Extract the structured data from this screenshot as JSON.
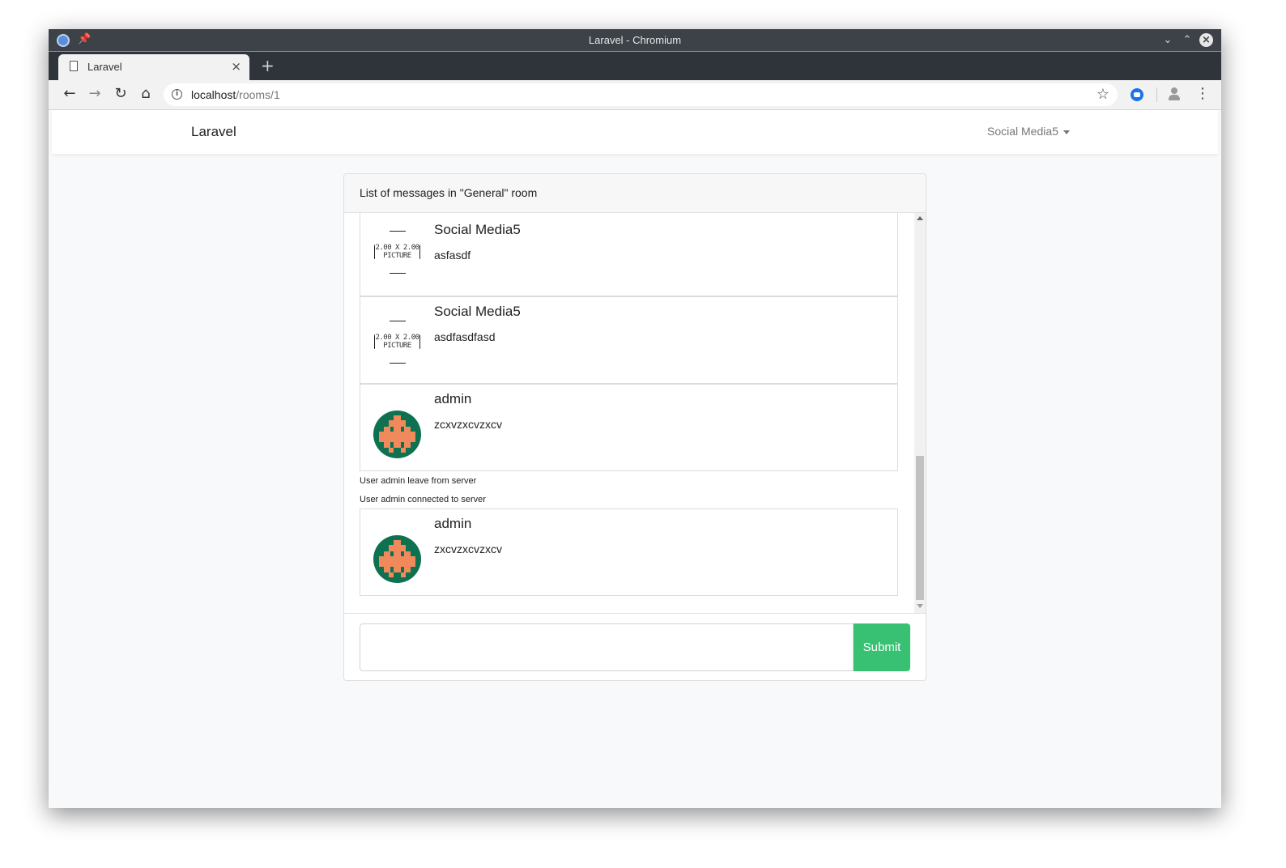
{
  "window": {
    "title": "Laravel - Chromium"
  },
  "tab": {
    "label": "Laravel"
  },
  "address": {
    "host": "localhost",
    "path": "/rooms/1"
  },
  "navbar": {
    "brand": "Laravel",
    "user": "Social Media5"
  },
  "card": {
    "header": "List of messages in \"General\" room"
  },
  "messages": [
    {
      "name": "Social Media5",
      "text": "asfasdf",
      "avatar_label": "2.00 X 2.00 PICTURE"
    },
    {
      "name": "Social Media5",
      "text": "asdfasdfasd",
      "avatar_label": "2.00 X 2.00 PICTURE"
    },
    {
      "name": "admin",
      "text": "zcxvzxcvzxcv"
    },
    {
      "name": "admin",
      "text": "zxcvzxcvzxcv"
    }
  ],
  "system_messages": [
    "User admin leave from server",
    "User admin connected to server"
  ],
  "form": {
    "input_value": "",
    "submit_label": "Submit"
  },
  "colors": {
    "submit": "#38c172",
    "invader_bg": "#0e7150",
    "invader_fg": "#f08a5d"
  }
}
